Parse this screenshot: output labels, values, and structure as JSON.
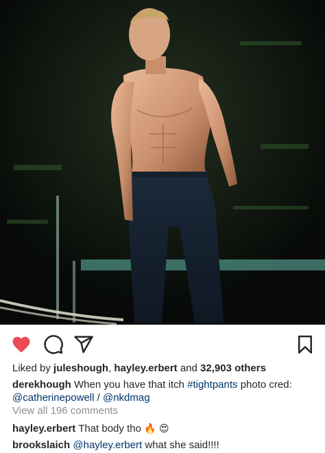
{
  "post": {
    "image_alt": "Shirtless performer in dark jeans standing on a dark stage",
    "liked_by_prefix": "Liked by",
    "liked_user_1": "juleshough",
    "liked_separator": ",",
    "liked_user_2": "hayley.erbert",
    "liked_and": "and",
    "liked_count": "32,903 others",
    "caption_user": "derekhough",
    "caption_text": "When you have that itch",
    "caption_hashtag": "#tightpants",
    "caption_text_2": "photo cred:",
    "caption_mention_1": "@catherinepowell",
    "caption_slash": "/",
    "caption_mention_2": "@nkdmag",
    "view_all_comments": "View all 196 comments",
    "comments": [
      {
        "user": "hayley.erbert",
        "text": "That body tho",
        "emoji": "🔥 😍"
      },
      {
        "user": "brookslaich",
        "mention": "@hayley.erbert",
        "text": "what she said!!!!"
      }
    ]
  },
  "icons": {
    "like": "heart-icon",
    "comment": "comment-icon",
    "share": "share-icon",
    "save": "bookmark-icon"
  },
  "colors": {
    "like_red": "#ed4956",
    "link_blue": "#003569",
    "muted_gray": "#8e8e8e",
    "text": "#262626"
  }
}
